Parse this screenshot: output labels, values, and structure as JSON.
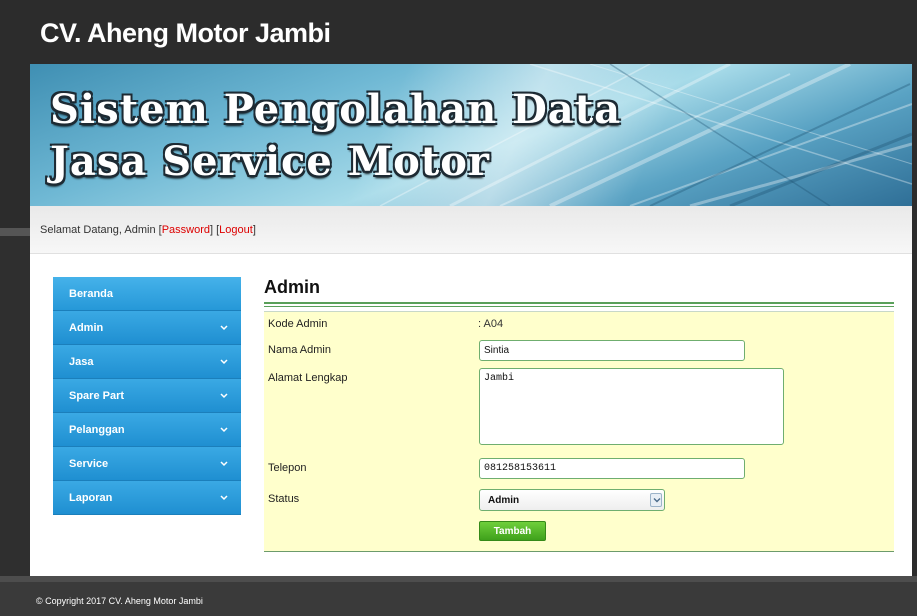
{
  "header": {
    "site_title": "CV. Aheng Motor Jambi",
    "banner_line1": "Sistem Pengolahan Data",
    "banner_line2": "Jasa Service Motor"
  },
  "welcome": {
    "prefix": "Selamat Datang, Admin ",
    "open1": "[",
    "password_link": "Password",
    "close1": "] ",
    "open2": "[",
    "logout_link": "Logout",
    "close2": "]"
  },
  "sidebar": {
    "items": [
      {
        "label": "Beranda",
        "has_chevron": false
      },
      {
        "label": "Admin",
        "has_chevron": true
      },
      {
        "label": "Jasa",
        "has_chevron": true
      },
      {
        "label": "Spare Part",
        "has_chevron": true
      },
      {
        "label": "Pelanggan",
        "has_chevron": true
      },
      {
        "label": "Service",
        "has_chevron": true
      },
      {
        "label": "Laporan",
        "has_chevron": true
      }
    ]
  },
  "main": {
    "title": "Admin",
    "form": {
      "kode_label": "Kode Admin",
      "kode_value": ": A04",
      "nama_label": "Nama Admin",
      "nama_value": "Sintia",
      "alamat_label": "Alamat Lengkap",
      "alamat_value": "Jambi",
      "telepon_label": "Telepon",
      "telepon_value": "081258153611",
      "status_label": "Status",
      "status_value": "Admin",
      "submit_label": "Tambah"
    }
  },
  "footer": {
    "copyright": "© Copyright 2017 CV. Aheng Motor Jambi"
  },
  "colors": {
    "sidebar_blue": "#2698d8",
    "form_bg": "#ffffcc",
    "button_green": "#3fa11b",
    "link_red": "#dd0000"
  }
}
